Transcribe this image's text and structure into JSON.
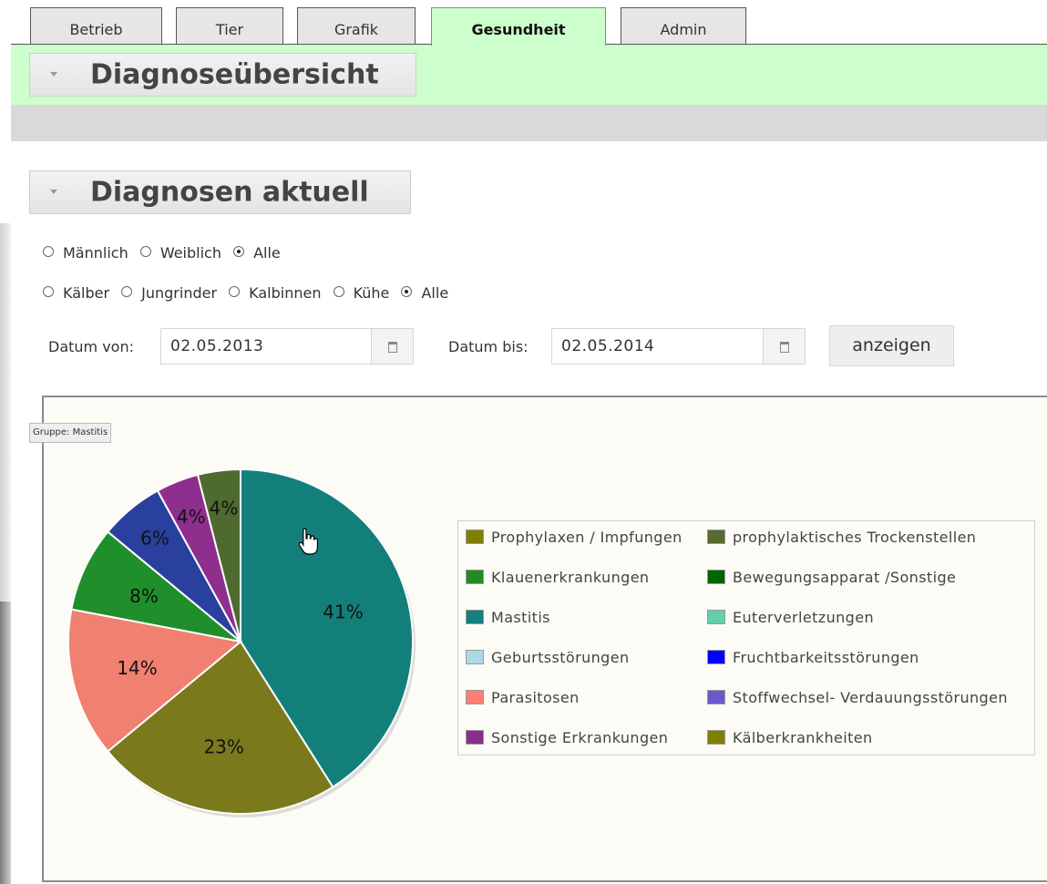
{
  "tabs": [
    {
      "label": "Betrieb",
      "active": false
    },
    {
      "label": "Tier",
      "active": false
    },
    {
      "label": "Grafik",
      "active": false
    },
    {
      "label": "Gesundheit",
      "active": true
    },
    {
      "label": "Admin",
      "active": false
    }
  ],
  "section_overview": {
    "title": "Diagnoseübersicht"
  },
  "section_current": {
    "title": "Diagnosen aktuell"
  },
  "gender_filter": {
    "options": [
      "Männlich",
      "Weiblich",
      "Alle"
    ],
    "selected": "Alle"
  },
  "category_filter": {
    "options": [
      "Kälber",
      "Jungrinder",
      "Kalbinnen",
      "Kühe",
      "Alle"
    ],
    "selected": "Alle"
  },
  "date_filter": {
    "from_label": "Datum von:",
    "from_value": "02.05.2013",
    "to_label": "Datum bis:",
    "to_value": "02.05.2014",
    "submit_label": "anzeigen"
  },
  "tooltip": {
    "text": "Gruppe: Mastitis"
  },
  "chart_data": {
    "type": "pie",
    "slices": [
      {
        "name": "Mastitis",
        "value": 41,
        "label": "41%",
        "color": "#137f7b"
      },
      {
        "name": "Kälberkrankheiten",
        "value": 23,
        "label": "23%",
        "color": "#7a7a1c"
      },
      {
        "name": "Parasitosen",
        "value": 14,
        "label": "14%",
        "color": "#f08070"
      },
      {
        "name": "Klauenerkrankungen",
        "value": 8,
        "label": "8%",
        "color": "#1f8f2c"
      },
      {
        "name": "Fruchtbarkeitsstörungen",
        "value": 6,
        "label": "6%",
        "color": "#2a409e"
      },
      {
        "name": "Sonstige Erkrankungen",
        "value": 4,
        "label": "4%",
        "color": "#8e2f8e"
      },
      {
        "name": "prophylaktisches Trockenstellen",
        "value": 4,
        "label": "4%",
        "color": "#4f6a2f"
      }
    ],
    "legend": {
      "placement": "right",
      "entries": [
        {
          "name": "Prophylaxen / Impfungen",
          "color": "#808000"
        },
        {
          "name": "prophylaktisches Trockenstellen",
          "color": "#556b2f"
        },
        {
          "name": "Klauenerkrankungen",
          "color": "#228b22"
        },
        {
          "name": "Bewegungsapparat /Sonstige",
          "color": "#006400"
        },
        {
          "name": "Mastitis",
          "color": "#138080"
        },
        {
          "name": "Euterverletzungen",
          "color": "#66cdaa"
        },
        {
          "name": "Geburtsstörungen",
          "color": "#add8e6"
        },
        {
          "name": "Fruchtbarkeitsstörungen",
          "color": "#0000ff"
        },
        {
          "name": "Parasitosen",
          "color": "#fa8072"
        },
        {
          "name": "Stoffwechsel- Verdauungsstörungen",
          "color": "#6a5acd"
        },
        {
          "name": "Sonstige Erkrankungen",
          "color": "#8b2e8b"
        },
        {
          "name": "Kälberkrankheiten",
          "color": "#808000"
        }
      ]
    }
  }
}
